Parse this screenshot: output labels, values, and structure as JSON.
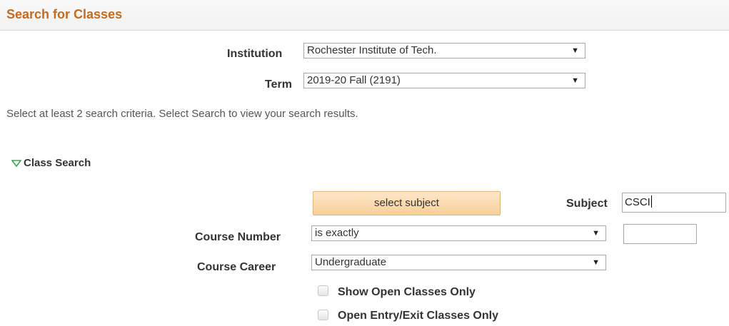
{
  "header": {
    "title": "Search for Classes"
  },
  "institution": {
    "label": "Institution",
    "value": "Rochester Institute of Tech."
  },
  "term": {
    "label": "Term",
    "value": "2019-20 Fall (2191)"
  },
  "instructions": "Select at least 2 search criteria. Select Search to view your search results.",
  "class_search": {
    "section_label": "Class Search",
    "select_subject_button": "select subject",
    "subject": {
      "label": "Subject",
      "value": "CSCI"
    },
    "course_number": {
      "label": "Course Number",
      "operator": "is exactly",
      "value": ""
    },
    "course_career": {
      "label": "Course Career",
      "value": "Undergraduate"
    },
    "show_open_only": {
      "label": "Show Open Classes Only",
      "checked": false
    },
    "open_entry_exit_only": {
      "label": "Open Entry/Exit Classes Only",
      "checked": false
    }
  },
  "icons": {
    "dropdown": "triangle-down-icon",
    "section_toggle": "expand-triangle-icon"
  },
  "colors": {
    "title": "#c8691c",
    "button_bg": "#f9cf99",
    "section_arrow": "#3aa94a"
  }
}
